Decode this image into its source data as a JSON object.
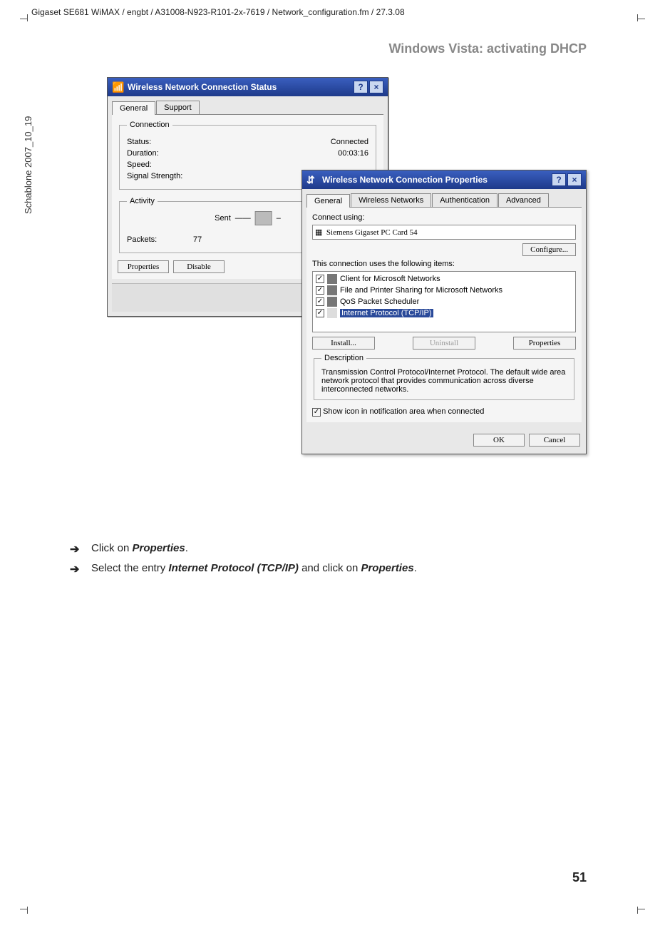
{
  "doc": {
    "head_path": "Gigaset SE681 WiMAX / engbt / A31008-N923-R101-2x-7619 / Network_configuration.fm / 27.3.08",
    "side": "Schablone 2007_10_19",
    "section": "Windows Vista: activating DHCP",
    "page": "51"
  },
  "status_win": {
    "title": "Wireless Network Connection Status",
    "tabs": {
      "general": "General",
      "support": "Support"
    },
    "connection_legend": "Connection",
    "status_label": "Status:",
    "status_val": "Connected",
    "duration_label": "Duration:",
    "duration_val": "00:03:16",
    "speed_label": "Speed:",
    "signal_label": "Signal Strength:",
    "activity_legend": "Activity",
    "sent": "Sent",
    "packets_label": "Packets:",
    "packets_val": "77",
    "btn_properties": "Properties",
    "btn_disable": "Disable"
  },
  "props_win": {
    "title": "Wireless Network Connection Properties",
    "tabs": {
      "general": "General",
      "wireless": "Wireless Networks",
      "auth": "Authentication",
      "adv": "Advanced"
    },
    "connect_using": "Connect using:",
    "adapter": "Siemens Gigaset PC Card 54",
    "configure": "Configure...",
    "items_label": "This connection uses the following items:",
    "items": {
      "a": "Client for Microsoft Networks",
      "b": "File and Printer Sharing for Microsoft Networks",
      "c": "QoS Packet Scheduler",
      "d": "Internet Protocol (TCP/IP)"
    },
    "install": "Install...",
    "uninstall": "Uninstall",
    "properties": "Properties",
    "desc_legend": "Description",
    "desc_text": "Transmission Control Protocol/Internet Protocol. The default wide area network protocol that provides communication across diverse interconnected networks.",
    "show_icon": "Show icon in notification area when connected",
    "ok": "OK",
    "cancel": "Cancel"
  },
  "instr": {
    "line1_a": "Click on ",
    "line1_b": "Properties",
    "line1_c": ".",
    "line2_a": "Select the entry ",
    "line2_b": "Internet Protocol (TCP/IP)",
    "line2_c": " and click on ",
    "line2_d": "Properties",
    "line2_e": "."
  }
}
